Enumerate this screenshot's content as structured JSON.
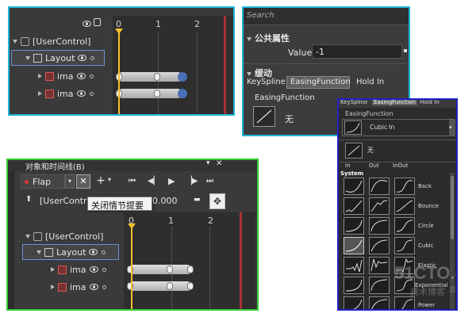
{
  "timeline_top": {
    "ruler": [
      "0",
      "1",
      "2"
    ],
    "rows": [
      {
        "label": "[UserControl]"
      },
      {
        "label": "Layout"
      },
      {
        "label": "ima"
      },
      {
        "label": "ima"
      }
    ]
  },
  "properties_panel": {
    "search_placeholder": "Search",
    "common_section": "公共属性",
    "value_label": "Value",
    "value": "-1",
    "easing_section": "缓动",
    "tabs": [
      "KeySpline",
      "EasingFunction",
      "Hold In"
    ],
    "easing_function_label": "EasingFunction",
    "easing_value": "无"
  },
  "easing_dropdown": {
    "tabs": [
      "KeySpline",
      "EasingFunction",
      "Hold In"
    ],
    "header": "EasingFunction",
    "current_label": "Cubic",
    "current_mode": "In",
    "none_label": "无",
    "modes": [
      "In",
      "Out",
      "InOut"
    ],
    "category": "System",
    "items": [
      "Back",
      "Bounce",
      "Circle",
      "Cubic",
      "Elastic",
      "Exponential",
      "Power"
    ]
  },
  "objects_timeline": {
    "title": "对象和时间线(B)",
    "storyboard": "Flap",
    "tooltip": "关闭情节提要",
    "time": "0.000",
    "scope_label": "[UserControl]",
    "ruler": [
      "0",
      "1",
      "2"
    ],
    "rows": [
      {
        "label": "[UserControl]"
      },
      {
        "label": "Layout"
      },
      {
        "label": "ima"
      },
      {
        "label": "ima"
      }
    ]
  },
  "watermark": {
    "line1": "51CTO.com",
    "line2": "技术博客",
    "line3": "Blog"
  },
  "colors": {
    "border_top_left": "#20b5d8",
    "border_top_right": "#20b5d8",
    "border_dropdown": "#2020c8",
    "border_bottom": "#33cc33",
    "playhead": "#f3c02b",
    "bar_end": "#4a6fb5"
  }
}
